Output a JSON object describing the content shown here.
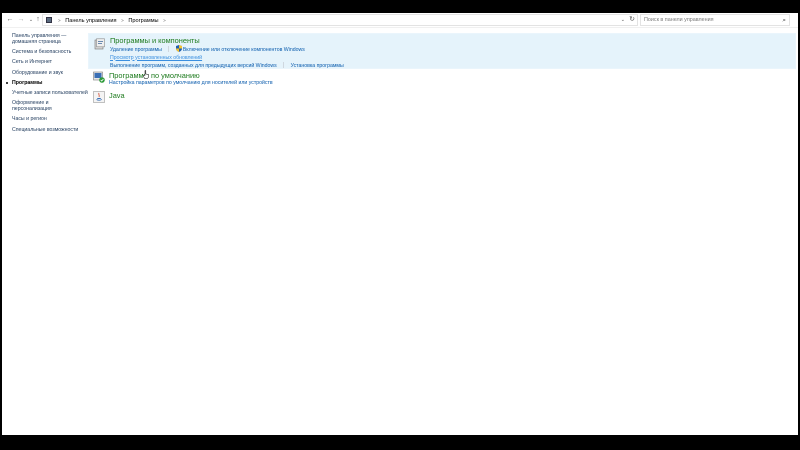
{
  "addressbar": {
    "back_icon": "arrow-left-icon",
    "forward_icon": "arrow-right-icon",
    "recent_icon": "chevron-down-icon",
    "up_icon": "arrow-up-icon",
    "crumbs": [
      "Панель управления",
      "Программы"
    ],
    "refresh_icon": "refresh-icon",
    "search_placeholder": "Поиск в панели управления"
  },
  "sidebar": {
    "items": [
      {
        "label": "Панель управления — домашняя страница"
      },
      {
        "label": "Система и безопасность"
      },
      {
        "label": "Сеть и Интернет"
      },
      {
        "label": "Оборудование и звук"
      },
      {
        "label": "Программы"
      },
      {
        "label": "Учетные записи пользователей"
      },
      {
        "label": "Оформление и персонализация"
      },
      {
        "label": "Часы и регион"
      },
      {
        "label": "Специальные возможности"
      }
    ],
    "current_index": 4
  },
  "sections": [
    {
      "title": "Программы и компоненты",
      "icon": "programs-features-icon",
      "rows": [
        [
          "Удаление программы",
          "Включение или отключение компонентов Windows"
        ],
        [
          "Просмотр установленных обновлений"
        ],
        [
          "Выполнение программ, созданных для предыдущих версий Windows",
          "Установка программы"
        ]
      ]
    },
    {
      "title": "Программы по умолчанию",
      "icon": "default-programs-icon",
      "rows": [
        [
          "Настройка параметров по умолчанию для носителей или устройств"
        ]
      ]
    },
    {
      "title": "Java",
      "icon": "java-icon",
      "rows": []
    }
  ],
  "colors": {
    "title_green": "#1e7b1e",
    "link_blue": "#0b5cad",
    "highlight_bg": "#e5f3fb"
  }
}
